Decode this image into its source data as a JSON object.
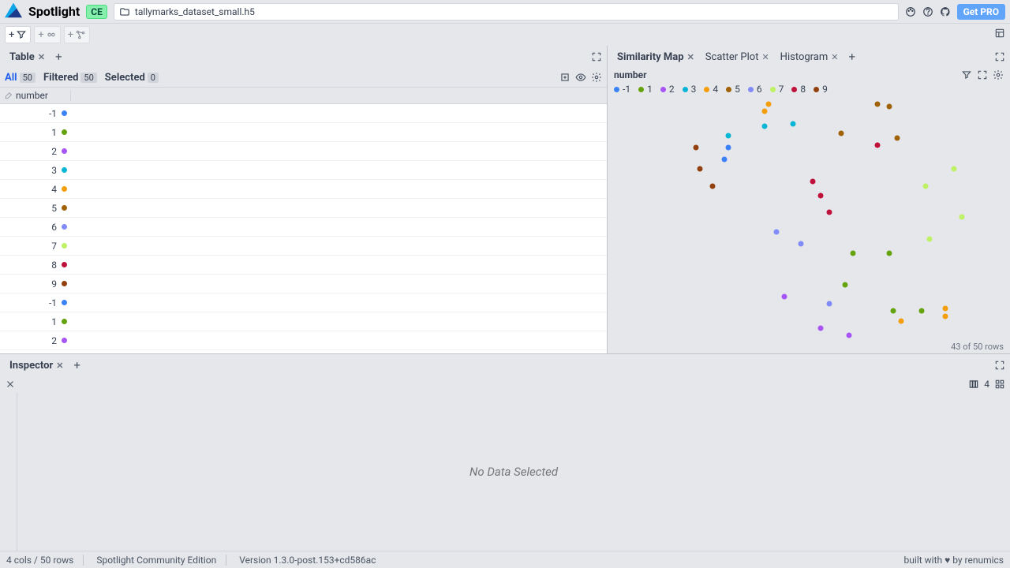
{
  "header": {
    "app_title": "Spotlight",
    "edition_badge": "CE",
    "filename": "tallymarks_dataset_small.h5",
    "get_pro_label": "Get PRO"
  },
  "toolbar": {},
  "left_panel": {
    "tabs": [
      {
        "label": "Table",
        "active": true
      }
    ],
    "filters": {
      "all_label": "All",
      "all_count": "50",
      "filtered_label": "Filtered",
      "filtered_count": "50",
      "selected_label": "Selected",
      "selected_count": "0"
    },
    "columns": [
      {
        "name": "number"
      }
    ],
    "rows": [
      {
        "value": "-1",
        "color": "#3b82f6"
      },
      {
        "value": "1",
        "color": "#65a30d"
      },
      {
        "value": "2",
        "color": "#a855f7"
      },
      {
        "value": "3",
        "color": "#06b6d4"
      },
      {
        "value": "4",
        "color": "#f59e0b"
      },
      {
        "value": "5",
        "color": "#a16207"
      },
      {
        "value": "6",
        "color": "#818cf8"
      },
      {
        "value": "7",
        "color": "#bef264"
      },
      {
        "value": "8",
        "color": "#be123c"
      },
      {
        "value": "9",
        "color": "#92400e"
      },
      {
        "value": "-1",
        "color": "#3b82f6"
      },
      {
        "value": "1",
        "color": "#65a30d"
      },
      {
        "value": "2",
        "color": "#a855f7"
      }
    ]
  },
  "right_panel": {
    "tabs": [
      {
        "label": "Similarity Map",
        "active": true
      },
      {
        "label": "Scatter Plot",
        "active": false
      },
      {
        "label": "Histogram",
        "active": false
      }
    ],
    "map": {
      "title": "number",
      "legend": [
        {
          "label": "-1",
          "color": "#3b82f6"
        },
        {
          "label": "1",
          "color": "#65a30d"
        },
        {
          "label": "2",
          "color": "#a855f7"
        },
        {
          "label": "3",
          "color": "#06b6d4"
        },
        {
          "label": "4",
          "color": "#f59e0b"
        },
        {
          "label": "5",
          "color": "#a16207"
        },
        {
          "label": "6",
          "color": "#818cf8"
        },
        {
          "label": "7",
          "color": "#bef264"
        },
        {
          "label": "8",
          "color": "#be123c"
        },
        {
          "label": "9",
          "color": "#92400e"
        }
      ],
      "footer": "43 of 50 rows"
    }
  },
  "chart_data": {
    "type": "scatter",
    "title": "number",
    "xlim": [
      0,
      100
    ],
    "ylim": [
      0,
      100
    ],
    "legend_items": [
      "-1",
      "1",
      "2",
      "3",
      "4",
      "5",
      "6",
      "7",
      "8",
      "9"
    ],
    "colors": {
      "-1": "#3b82f6",
      "1": "#65a30d",
      "2": "#a855f7",
      "3": "#06b6d4",
      "4": "#f59e0b",
      "5": "#a16207",
      "6": "#818cf8",
      "7": "#bef264",
      "8": "#be123c",
      "9": "#92400e"
    },
    "points": [
      {
        "cat": "-1",
        "x": 29,
        "y": 75
      },
      {
        "cat": "-1",
        "x": 30,
        "y": 80
      },
      {
        "cat": "9",
        "x": 22,
        "y": 80
      },
      {
        "cat": "9",
        "x": 23,
        "y": 71
      },
      {
        "cat": "9",
        "x": 26,
        "y": 64
      },
      {
        "cat": "3",
        "x": 30,
        "y": 85
      },
      {
        "cat": "3",
        "x": 39,
        "y": 89
      },
      {
        "cat": "3",
        "x": 46,
        "y": 90
      },
      {
        "cat": "5",
        "x": 67,
        "y": 98
      },
      {
        "cat": "5",
        "x": 70,
        "y": 97
      },
      {
        "cat": "5",
        "x": 58,
        "y": 86
      },
      {
        "cat": "5",
        "x": 72,
        "y": 84
      },
      {
        "cat": "4",
        "x": 40,
        "y": 98
      },
      {
        "cat": "4",
        "x": 39,
        "y": 95
      },
      {
        "cat": "4",
        "x": 73,
        "y": 8
      },
      {
        "cat": "4",
        "x": 84,
        "y": 13
      },
      {
        "cat": "4",
        "x": 84,
        "y": 10
      },
      {
        "cat": "8",
        "x": 67,
        "y": 81
      },
      {
        "cat": "8",
        "x": 53,
        "y": 60
      },
      {
        "cat": "8",
        "x": 55,
        "y": 53
      },
      {
        "cat": "8",
        "x": 51,
        "y": 66
      },
      {
        "cat": "7",
        "x": 79,
        "y": 64
      },
      {
        "cat": "7",
        "x": 86,
        "y": 71
      },
      {
        "cat": "7",
        "x": 80,
        "y": 42
      },
      {
        "cat": "7",
        "x": 88,
        "y": 51
      },
      {
        "cat": "1",
        "x": 61,
        "y": 36
      },
      {
        "cat": "1",
        "x": 70,
        "y": 36
      },
      {
        "cat": "1",
        "x": 71,
        "y": 12
      },
      {
        "cat": "1",
        "x": 78,
        "y": 12
      },
      {
        "cat": "1",
        "x": 59,
        "y": 23
      },
      {
        "cat": "6",
        "x": 42,
        "y": 45
      },
      {
        "cat": "6",
        "x": 48,
        "y": 40
      },
      {
        "cat": "6",
        "x": 55,
        "y": 15
      },
      {
        "cat": "2",
        "x": 60,
        "y": 2
      },
      {
        "cat": "2",
        "x": 53,
        "y": 5
      },
      {
        "cat": "2",
        "x": 44,
        "y": 18
      }
    ]
  },
  "inspector": {
    "tabs": [
      {
        "label": "Inspector",
        "active": true
      }
    ],
    "columns_badge": "4",
    "empty_text": "No Data Selected"
  },
  "statusbar": {
    "cols_rows": "4 cols / 50 rows",
    "edition": "Spotlight Community Edition",
    "version": "Version 1.3.0-post.153+cd586ac",
    "built_with": "built with ♥ by renumics"
  }
}
